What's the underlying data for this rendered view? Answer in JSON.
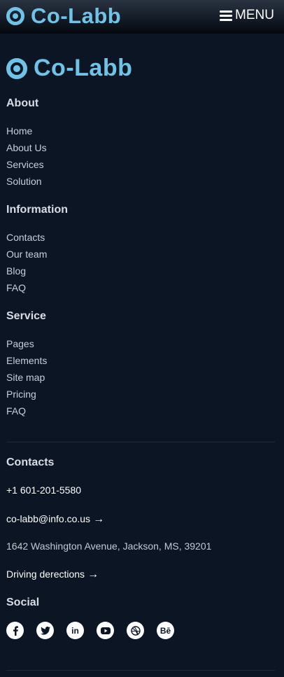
{
  "header": {
    "logo_text": "Co-Labb",
    "menu_label": "MENU"
  },
  "footer": {
    "logo_text": "Co-Labb",
    "about": {
      "heading": "About",
      "links": [
        "Home",
        "About Us",
        "Services",
        "Solution"
      ]
    },
    "information": {
      "heading": "Information",
      "links": [
        "Contacts",
        "Our team",
        "Blog",
        "FAQ"
      ]
    },
    "service": {
      "heading": "Service",
      "links": [
        "Pages",
        "Elements",
        "Site map",
        "Pricing",
        "FAQ"
      ]
    },
    "contacts": {
      "heading": "Contacts",
      "phone": "+1 601-201-5580",
      "email": "co-labb@info.co.us",
      "address": "1642 Washington Avenue, Jackson, MS, 39201",
      "directions": "Driving derections"
    },
    "social": {
      "heading": "Social",
      "icons": [
        "facebook-icon",
        "twitter-icon",
        "linkedin-icon",
        "youtube-icon",
        "dribbble-icon",
        "behance-icon"
      ],
      "linkedin_text": "in",
      "behance_text": "Bē"
    }
  },
  "colors": {
    "background": "#0b1524",
    "accent": "#6fc3e6",
    "text": "#c8cfd9"
  }
}
